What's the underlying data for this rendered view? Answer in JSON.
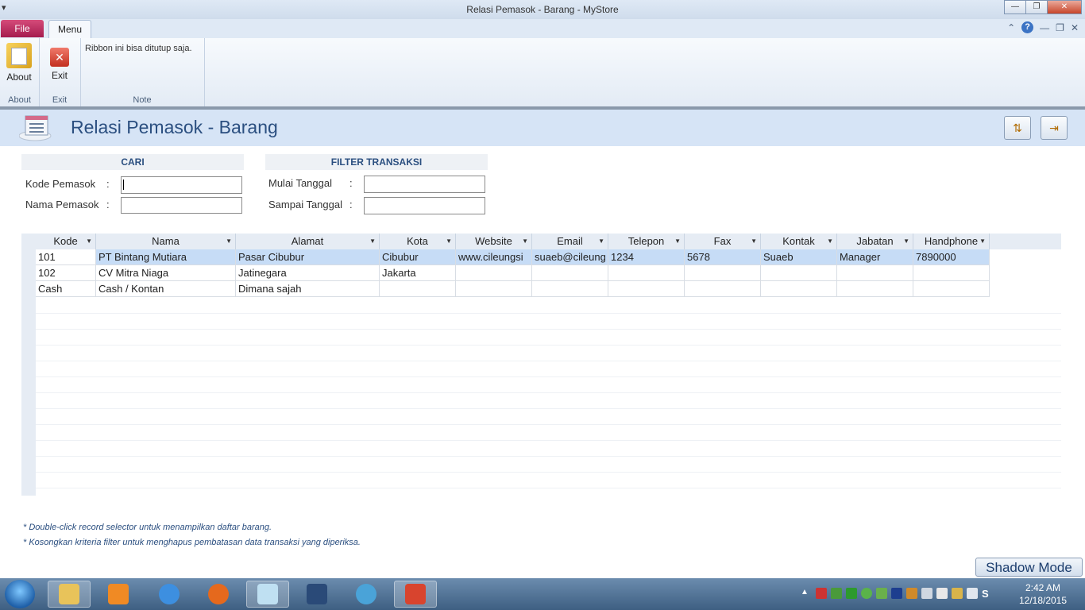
{
  "window": {
    "title": "Relasi Pemasok - Barang  -  MyStore"
  },
  "ribbon": {
    "tabs": [
      {
        "label": "File"
      },
      {
        "label": "Menu"
      }
    ],
    "groups": {
      "about": {
        "button_label": "About",
        "group_label": "About"
      },
      "exit": {
        "button_label": "Exit",
        "group_label": "Exit"
      },
      "note": {
        "text": "Ribbon ini bisa ditutup saja.",
        "group_label": "Note"
      }
    }
  },
  "form": {
    "title": "Relasi Pemasok - Barang"
  },
  "search": {
    "header": "CARI",
    "kode_label": "Kode Pemasok",
    "nama_label": "Nama Pemasok",
    "colon": ":",
    "kode_value": "",
    "nama_value": ""
  },
  "filter": {
    "header": "FILTER TRANSAKSI",
    "mulai_label": "Mulai Tanggal",
    "sampai_label": "Sampai Tanggal",
    "colon": ":",
    "mulai_value": "",
    "sampai_value": ""
  },
  "table": {
    "columns": [
      "Kode",
      "Nama",
      "Alamat",
      "Kota",
      "Website",
      "Email",
      "Telepon",
      "Fax",
      "Kontak",
      "Jabatan",
      "Handphone"
    ],
    "rows": [
      [
        "101",
        "PT Bintang Mutiara",
        "Pasar Cibubur",
        "Cibubur",
        "www.cileungsi",
        "suaeb@cileung",
        "1234",
        "5678",
        "Suaeb",
        "Manager",
        "7890000"
      ],
      [
        "102",
        "CV Mitra Niaga",
        "Jatinegara",
        "Jakarta",
        "",
        "",
        "",
        "",
        "",
        "",
        ""
      ],
      [
        "Cash",
        "Cash / Kontan",
        "Dimana sajah",
        "",
        "",
        "",
        "",
        "",
        "",
        "",
        ""
      ]
    ],
    "selected_row": 0
  },
  "notes": [
    "* Double-click record selector untuk menampilkan daftar barang.",
    "* Kosongkan kriteria filter untuk menghapus pembatasan data transaksi yang diperiksa."
  ],
  "shadow_mode_label": "Shadow Mode",
  "taskbar": {
    "time": "2:42 AM",
    "date": "12/18/2015"
  },
  "colors": {
    "accent": "#2b4f80",
    "header_band": "#d6e4f6",
    "file_tab": "#a51c4e",
    "selected_row": "#c6dcf6"
  }
}
